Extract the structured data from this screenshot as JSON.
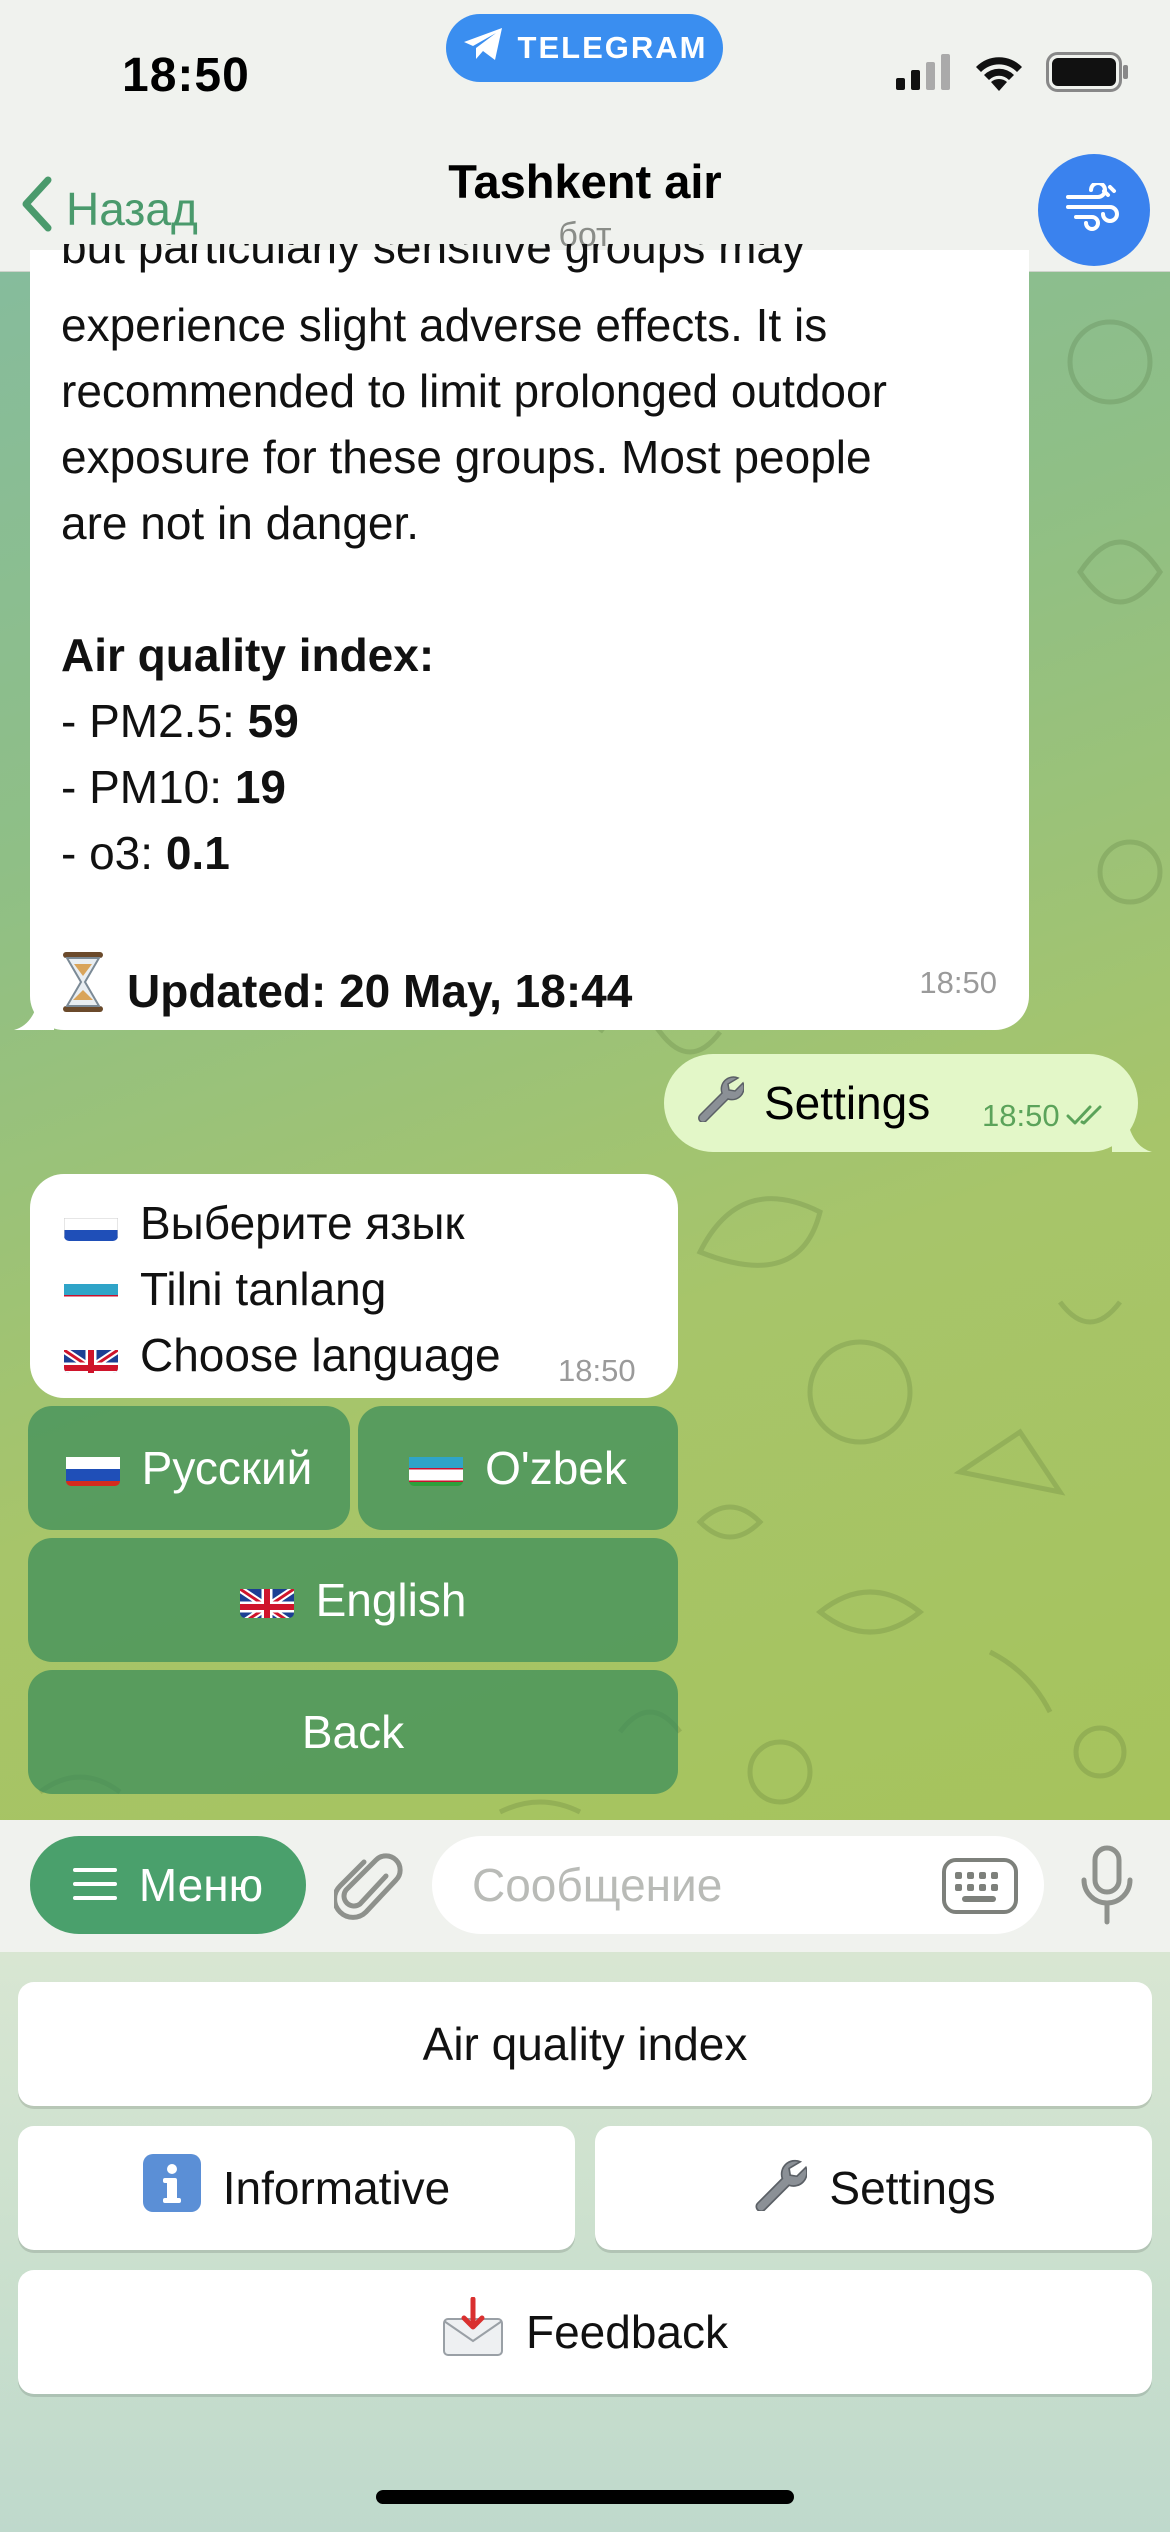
{
  "status_bar": {
    "time": "18:50",
    "return_app_label": "TELEGRAM"
  },
  "header": {
    "back_label": "Назад",
    "title": "Tashkent air",
    "subtitle": "бот",
    "avatar_icon": "wind-icon",
    "avatar_color": "#3a82ee"
  },
  "messages": {
    "air_report": {
      "clipped_line": "but particularly sensitive groups may",
      "paragraph_lines": [
        "experience slight adverse effects. It is",
        "recommended to limit prolonged outdoor",
        "exposure for these groups. Most people",
        "are not in danger."
      ],
      "index_heading": "Air quality index:",
      "pm25_label": "- PM2.5: ",
      "pm25_value": "59",
      "pm10_label": "- PM10: ",
      "pm10_value": "19",
      "o3_label": "- o3: ",
      "o3_value": "0.1",
      "updated_icon": "hourglass-icon",
      "updated_text": "Updated: 20 May, 18:44",
      "time": "18:50"
    },
    "settings_sent": {
      "icon": "wrench-icon",
      "text": "Settings",
      "time": "18:50",
      "status_icon": "double-check-icon"
    },
    "language_prompt": {
      "lines": [
        {
          "flag": "russia-flag-icon",
          "text": "Выберите язык"
        },
        {
          "flag": "uzbekistan-flag-icon",
          "text": "Tilni tanlang"
        },
        {
          "flag": "uk-flag-icon",
          "text": "Choose language"
        }
      ],
      "time": "18:50"
    }
  },
  "inline_keyboard": {
    "russian": "Русский",
    "uzbek": "O'zbek",
    "english": "English",
    "back": "Back"
  },
  "input": {
    "menu_label": "Меню",
    "placeholder": "Сообщение",
    "value": ""
  },
  "reply_keyboard": {
    "air_quality": "Air quality index",
    "informative": "Informative",
    "settings": "Settings",
    "feedback": "Feedback"
  },
  "colors": {
    "accent_green": "#4aa06c",
    "outgoing_bubble": "#e3f7c8",
    "telegram_blue": "#3a8ef0"
  }
}
